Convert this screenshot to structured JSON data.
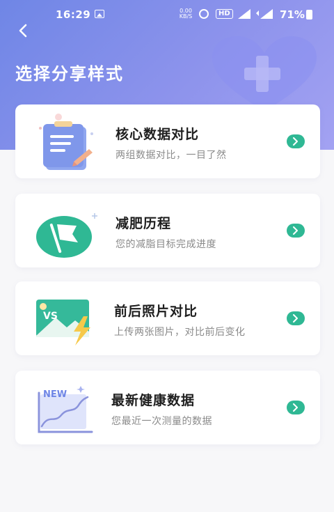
{
  "status_bar": {
    "time": "16:29",
    "net_speed_value": "0.00",
    "net_speed_unit": "KB/S",
    "hd": "HD",
    "battery": "71%"
  },
  "header": {
    "title": "选择分享样式"
  },
  "cards": [
    {
      "title": "核心数据对比",
      "subtitle": "两组数据对比，一目了然"
    },
    {
      "title": "减肥历程",
      "subtitle": "您的减脂目标完成进度"
    },
    {
      "title": "前后照片对比",
      "subtitle": "上传两张图片，对比前后变化",
      "badge": "VS"
    },
    {
      "title": "最新健康数据",
      "subtitle": "您最近一次测量的数据",
      "badge": "NEW"
    }
  ],
  "colors": {
    "header_start": "#6f86e6",
    "header_end": "#a3a2f2",
    "accent_green": "#2fb894"
  }
}
